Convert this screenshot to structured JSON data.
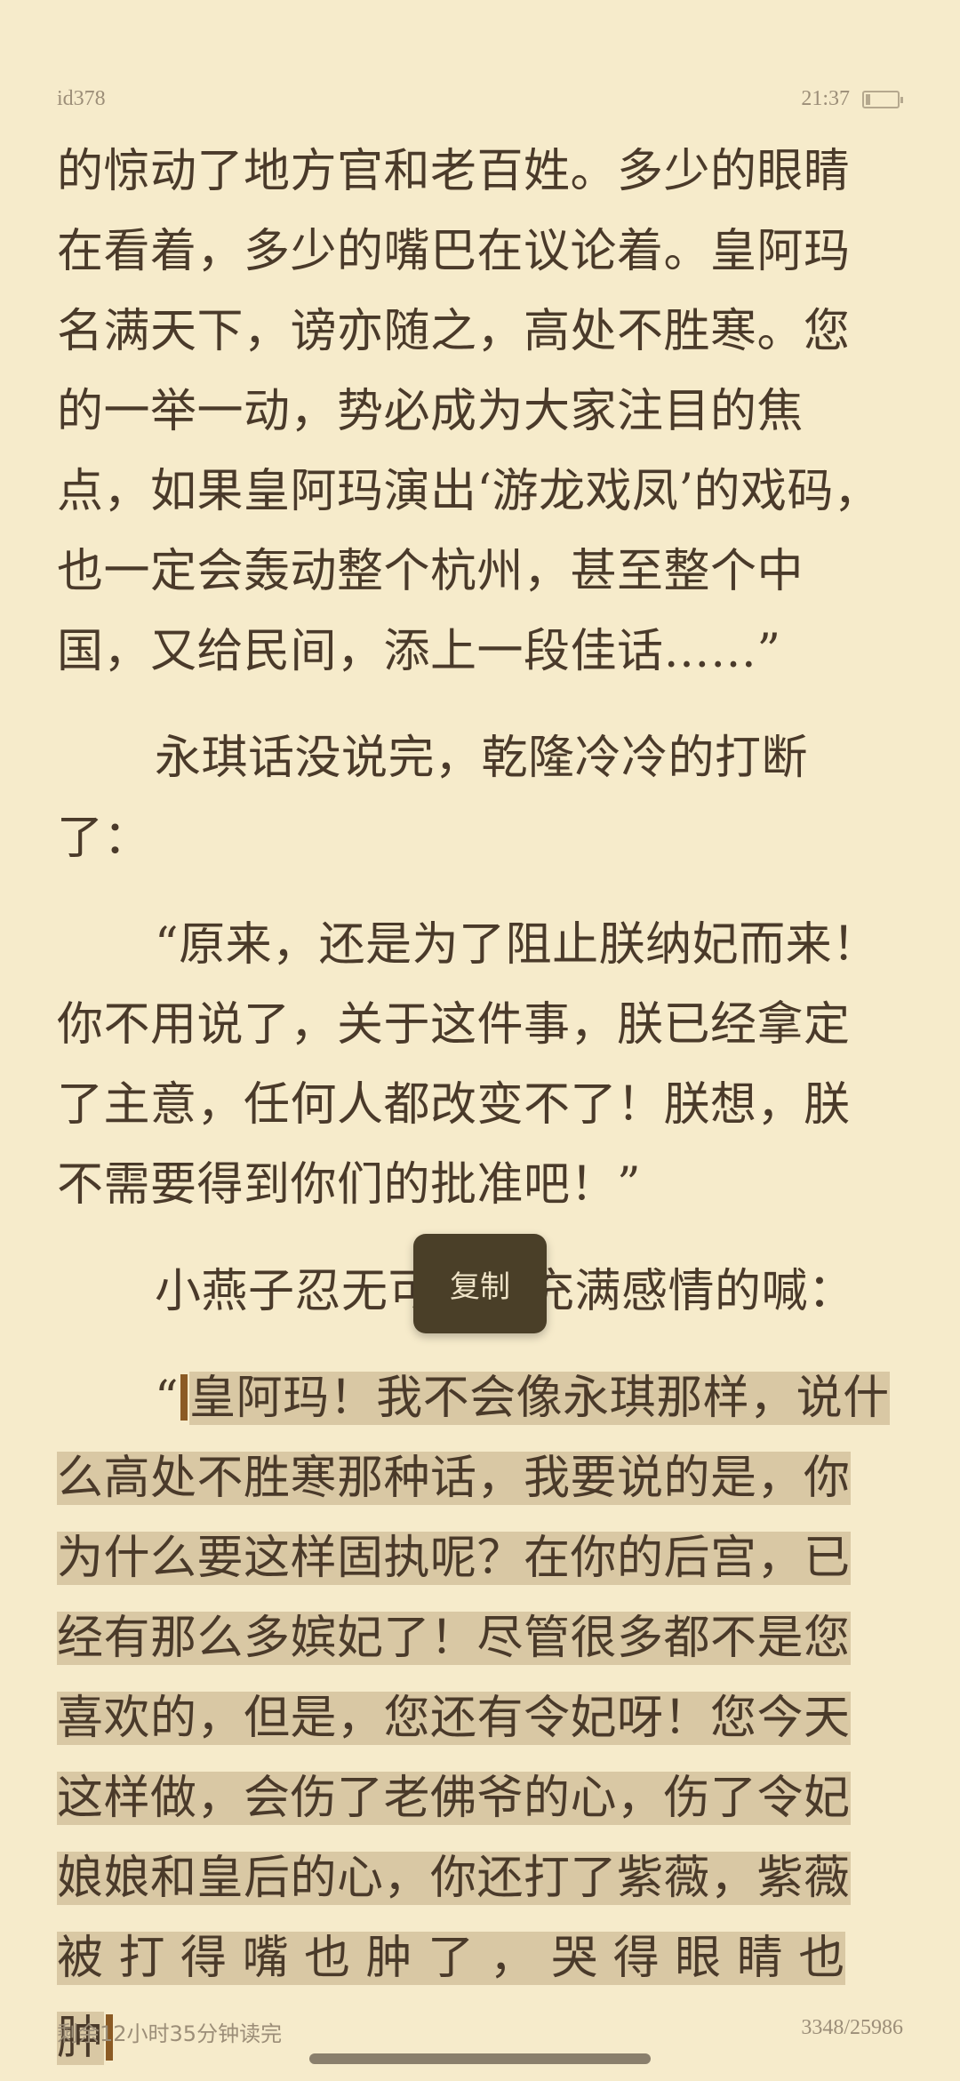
{
  "status": {
    "book_id": "id378",
    "time": "21:37",
    "battery_level": 0.15
  },
  "paragraphs": [
    {
      "lines": [
        "的惊动了地方官和老百姓。多少的眼睛",
        "在看着，多少的嘴巴在议论着。皇阿玛",
        "名满天下，谤亦随之，高处不胜寒。您",
        "的一举一动，势必成为大家注目的焦",
        "点，如果皇阿玛演出‘游龙戏凤’的戏码，",
        "也一定会轰动整个杭州，甚至整个中",
        "国，又给民间，添上一段佳话……”"
      ]
    },
    {
      "lines": [
        "永琪话没说完，乾隆冷冷的打断",
        "了："
      ]
    },
    {
      "lines": [
        "“原来，还是为了阻止朕纳妃而来！",
        "你不用说了，关于这件事，朕已经拿定",
        "了主意，任何人都改变不了！朕想，朕",
        "不需要得到你们的批准吧！”"
      ]
    },
    {
      "lines": [
        "小燕子忍无可忍，充满感情的喊："
      ]
    }
  ],
  "selected_paragraph": {
    "quote_mark": "“",
    "first_line": "皇阿玛！我不会像永琪那样，说什",
    "lines": [
      "么高处不胜寒那种话，我要说的是，你",
      "为什么要这样固执呢？在你的后宫，已",
      "经有那么多嫔妃了！尽管很多都不是您",
      "喜欢的，但是，您还有令妃呀！您今天",
      "这样做，会伤了老佛爷的心，伤了令妃",
      "娘娘和皇后的心，你还打了紫薇，紫薇",
      "被 打 得 嘴 也 肿 了 ， 哭 得 眼 睛 也 肿"
    ]
  },
  "popup": {
    "copy_label": "复制"
  },
  "footer": {
    "time_left": "剩余12小时35分钟读完",
    "page_progress": "3348/25986"
  }
}
